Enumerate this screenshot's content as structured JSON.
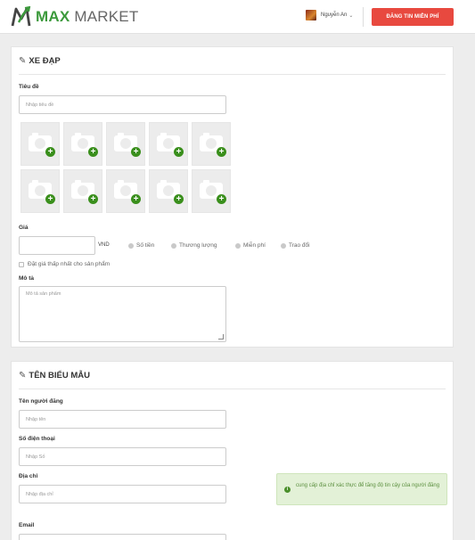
{
  "header": {
    "logo_max": "MAX",
    "logo_market": "MARKET",
    "user_name": "Nguyễn An",
    "post_button": "ĐĂNG TIN MIỄN PHÍ"
  },
  "section1": {
    "title": "XE ĐẠP",
    "title_label": "Tiêu đề",
    "title_placeholder": "Nhập tiêu đề",
    "price_label": "Giá",
    "currency": "VND",
    "price_options": [
      "Số tiền",
      "Thương lượng",
      "Miễn phí",
      "Trao đổi"
    ],
    "lowest_price_checkbox": "Đặt giá thấp nhất cho sản phẩm",
    "description_label": "Mô tả",
    "description_placeholder": "Mô tả sản phẩm",
    "photo_slots": 10
  },
  "section2": {
    "title": "TÊN BIỂU MẪU",
    "poster_label": "Tên người đăng",
    "poster_placeholder": "Nhập tên",
    "phone_label": "Số điện thoại",
    "phone_placeholder": "Nhập Số",
    "address_label": "Địa chỉ",
    "address_placeholder": "Nhập địa chỉ",
    "email_label": "Email",
    "hint_text": "cung cấp địa chỉ xác thực để tăng độ tin cậy của người đăng"
  },
  "colors": {
    "brand_green": "#3c9a3c",
    "post_button": "#e8493f",
    "add_photo": "#3a8f1c",
    "hint_bg": "#e3f1d7"
  },
  "icons": [
    "logo-mark-icon",
    "edit-icon",
    "camera-icon",
    "add-icon",
    "chevron-down-icon",
    "info-icon"
  ]
}
